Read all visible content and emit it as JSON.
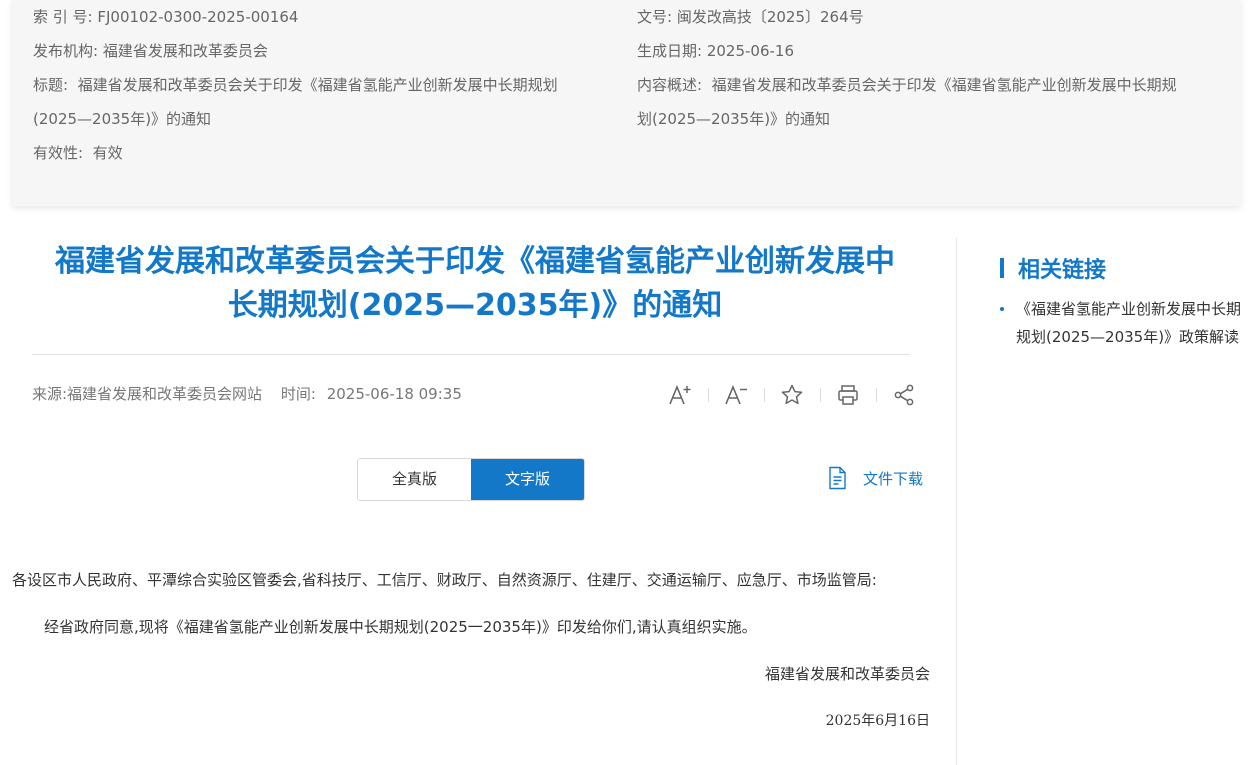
{
  "meta": {
    "left": [
      {
        "label": "索 引 号:",
        "value": "FJ00102-0300-2025-00164"
      },
      {
        "label": "发布机构:",
        "value": "福建省发展和改革委员会"
      },
      {
        "label": "标题:",
        "value": "福建省发展和改革委员会关于印发《福建省氢能产业创新发展中长期规划",
        "value2": "(2025—2035年)》的通知"
      },
      {
        "label": "有效性:",
        "value": "有效"
      }
    ],
    "right": [
      {
        "label": "文号:",
        "value": "闽发改高技〔2025〕264号"
      },
      {
        "label": "生成日期:",
        "value": "2025-06-16"
      },
      {
        "label": "内容概述:",
        "value": "福建省发展和改革委员会关于印发《福建省氢能产业创新发展中长期规",
        "value2": "划(2025—2035年)》的通知"
      }
    ]
  },
  "article": {
    "title_line1": "福建省发展和改革委员会关于印发《福建省氢能产业创新发展中",
    "title_line2": "长期规划(2025—2035年)》的通知",
    "source": "来源:福建省发展和改革委员会网站",
    "time_label": "时间:",
    "time_value": "2025-06-18 09:35",
    "tabs": [
      "全真版",
      "文字版"
    ],
    "active_tab": "文字版",
    "download_label": "文件下载",
    "paragraph1": "各设区市人民政府、平潭综合实验区管委会,省科技厅、工信厅、财政厅、自然资源厅、住建厅、交通运输厅、应急厅、市场监管局:",
    "paragraph2": "经省政府同意,现将《福建省氢能产业创新发展中长期规划(2025一2035年)》印发给你们,请认真组织实施。",
    "signature": "福建省发展和改革委员会",
    "date": "2025年6月16日"
  },
  "tools": {
    "font_larger": "A⁺",
    "font_smaller": "A⁻"
  },
  "related": {
    "title": "相关链接",
    "items": [
      "《福建省氢能产业创新发展中长期规划(2025—2035年)》政策解读"
    ]
  },
  "colors": {
    "accent": "#1478c9",
    "meta_bg": "#f6f6f6"
  }
}
